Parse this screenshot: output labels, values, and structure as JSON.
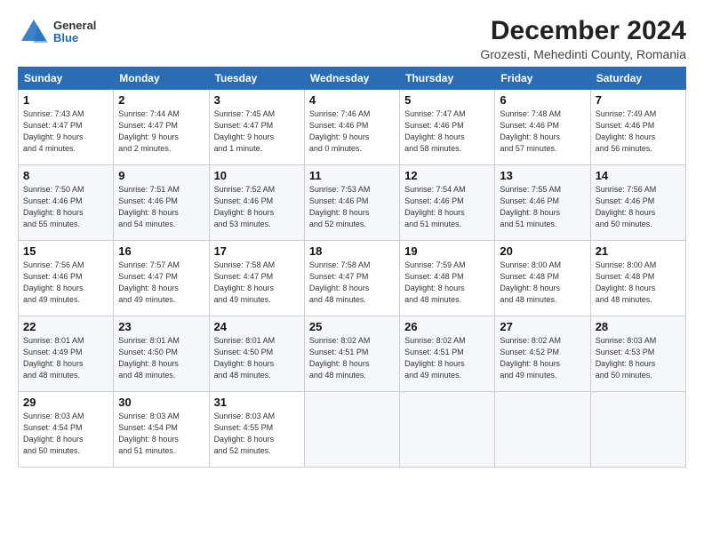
{
  "header": {
    "logo_general": "General",
    "logo_blue": "Blue",
    "title": "December 2024",
    "subtitle": "Grozesti, Mehedinti County, Romania"
  },
  "weekdays": [
    "Sunday",
    "Monday",
    "Tuesday",
    "Wednesday",
    "Thursday",
    "Friday",
    "Saturday"
  ],
  "weeks": [
    [
      {
        "day": "1",
        "info": "Sunrise: 7:43 AM\nSunset: 4:47 PM\nDaylight: 9 hours\nand 4 minutes."
      },
      {
        "day": "2",
        "info": "Sunrise: 7:44 AM\nSunset: 4:47 PM\nDaylight: 9 hours\nand 2 minutes."
      },
      {
        "day": "3",
        "info": "Sunrise: 7:45 AM\nSunset: 4:47 PM\nDaylight: 9 hours\nand 1 minute."
      },
      {
        "day": "4",
        "info": "Sunrise: 7:46 AM\nSunset: 4:46 PM\nDaylight: 9 hours\nand 0 minutes."
      },
      {
        "day": "5",
        "info": "Sunrise: 7:47 AM\nSunset: 4:46 PM\nDaylight: 8 hours\nand 58 minutes."
      },
      {
        "day": "6",
        "info": "Sunrise: 7:48 AM\nSunset: 4:46 PM\nDaylight: 8 hours\nand 57 minutes."
      },
      {
        "day": "7",
        "info": "Sunrise: 7:49 AM\nSunset: 4:46 PM\nDaylight: 8 hours\nand 56 minutes."
      }
    ],
    [
      {
        "day": "8",
        "info": "Sunrise: 7:50 AM\nSunset: 4:46 PM\nDaylight: 8 hours\nand 55 minutes."
      },
      {
        "day": "9",
        "info": "Sunrise: 7:51 AM\nSunset: 4:46 PM\nDaylight: 8 hours\nand 54 minutes."
      },
      {
        "day": "10",
        "info": "Sunrise: 7:52 AM\nSunset: 4:46 PM\nDaylight: 8 hours\nand 53 minutes."
      },
      {
        "day": "11",
        "info": "Sunrise: 7:53 AM\nSunset: 4:46 PM\nDaylight: 8 hours\nand 52 minutes."
      },
      {
        "day": "12",
        "info": "Sunrise: 7:54 AM\nSunset: 4:46 PM\nDaylight: 8 hours\nand 51 minutes."
      },
      {
        "day": "13",
        "info": "Sunrise: 7:55 AM\nSunset: 4:46 PM\nDaylight: 8 hours\nand 51 minutes."
      },
      {
        "day": "14",
        "info": "Sunrise: 7:56 AM\nSunset: 4:46 PM\nDaylight: 8 hours\nand 50 minutes."
      }
    ],
    [
      {
        "day": "15",
        "info": "Sunrise: 7:56 AM\nSunset: 4:46 PM\nDaylight: 8 hours\nand 49 minutes."
      },
      {
        "day": "16",
        "info": "Sunrise: 7:57 AM\nSunset: 4:47 PM\nDaylight: 8 hours\nand 49 minutes."
      },
      {
        "day": "17",
        "info": "Sunrise: 7:58 AM\nSunset: 4:47 PM\nDaylight: 8 hours\nand 49 minutes."
      },
      {
        "day": "18",
        "info": "Sunrise: 7:58 AM\nSunset: 4:47 PM\nDaylight: 8 hours\nand 48 minutes."
      },
      {
        "day": "19",
        "info": "Sunrise: 7:59 AM\nSunset: 4:48 PM\nDaylight: 8 hours\nand 48 minutes."
      },
      {
        "day": "20",
        "info": "Sunrise: 8:00 AM\nSunset: 4:48 PM\nDaylight: 8 hours\nand 48 minutes."
      },
      {
        "day": "21",
        "info": "Sunrise: 8:00 AM\nSunset: 4:48 PM\nDaylight: 8 hours\nand 48 minutes."
      }
    ],
    [
      {
        "day": "22",
        "info": "Sunrise: 8:01 AM\nSunset: 4:49 PM\nDaylight: 8 hours\nand 48 minutes."
      },
      {
        "day": "23",
        "info": "Sunrise: 8:01 AM\nSunset: 4:50 PM\nDaylight: 8 hours\nand 48 minutes."
      },
      {
        "day": "24",
        "info": "Sunrise: 8:01 AM\nSunset: 4:50 PM\nDaylight: 8 hours\nand 48 minutes."
      },
      {
        "day": "25",
        "info": "Sunrise: 8:02 AM\nSunset: 4:51 PM\nDaylight: 8 hours\nand 48 minutes."
      },
      {
        "day": "26",
        "info": "Sunrise: 8:02 AM\nSunset: 4:51 PM\nDaylight: 8 hours\nand 49 minutes."
      },
      {
        "day": "27",
        "info": "Sunrise: 8:02 AM\nSunset: 4:52 PM\nDaylight: 8 hours\nand 49 minutes."
      },
      {
        "day": "28",
        "info": "Sunrise: 8:03 AM\nSunset: 4:53 PM\nDaylight: 8 hours\nand 50 minutes."
      }
    ],
    [
      {
        "day": "29",
        "info": "Sunrise: 8:03 AM\nSunset: 4:54 PM\nDaylight: 8 hours\nand 50 minutes."
      },
      {
        "day": "30",
        "info": "Sunrise: 8:03 AM\nSunset: 4:54 PM\nDaylight: 8 hours\nand 51 minutes."
      },
      {
        "day": "31",
        "info": "Sunrise: 8:03 AM\nSunset: 4:55 PM\nDaylight: 8 hours\nand 52 minutes."
      },
      null,
      null,
      null,
      null
    ]
  ]
}
